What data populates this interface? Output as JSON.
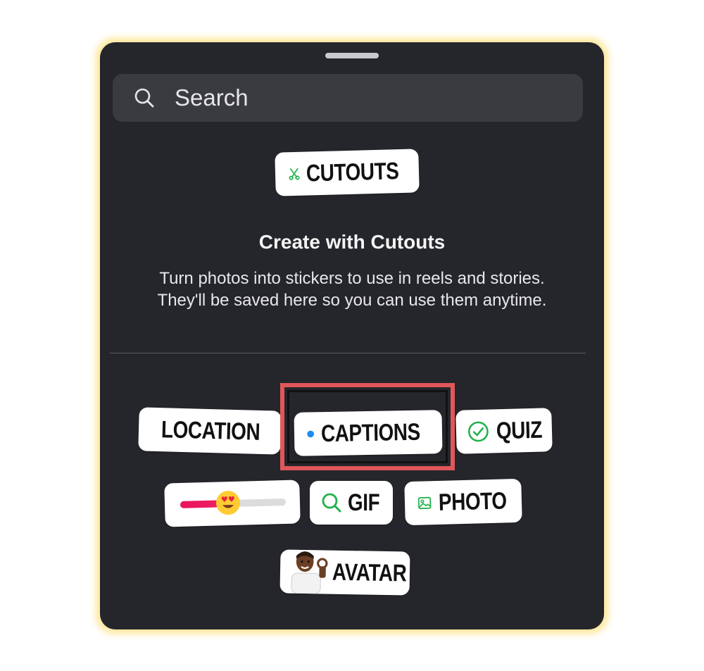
{
  "search": {
    "placeholder": "Search"
  },
  "featured": {
    "label": "CUTOUTS",
    "icon": "scissors-icon"
  },
  "intro": {
    "title": "Create with Cutouts",
    "description": "Turn photos into stickers to use in reels and stories. They'll be saved here so you can use them anytime."
  },
  "stickers": {
    "location": "LOCATION",
    "captions": "CAPTIONS",
    "captions_badge": "CC",
    "quiz": "QUIZ",
    "gif": "GIF",
    "photo": "PHOTO",
    "avatar": "AVATAR"
  },
  "slider": {
    "value": 0.45,
    "emoji": "heart-eyes-emoji"
  },
  "colors": {
    "panel": "#25262b",
    "search_bg": "#3a3b40",
    "accent_green": "#22b14c",
    "location_purple": "#8a3ffc",
    "captions_blue": "#1d8cf0",
    "highlight_red": "#e0575a",
    "glow_yellow": "#fde79a"
  }
}
